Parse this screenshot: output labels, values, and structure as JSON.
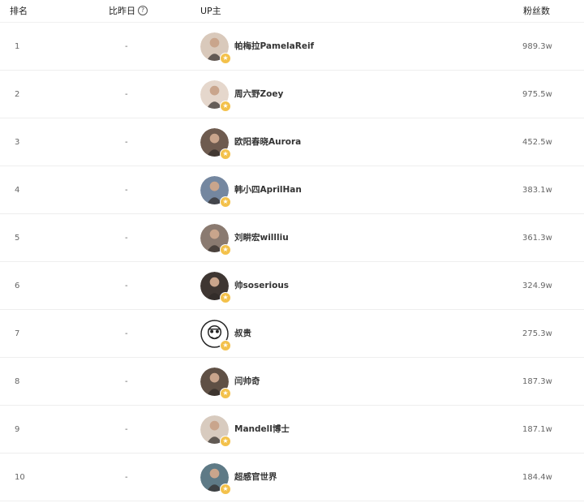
{
  "header": {
    "rank": "排名",
    "change": "比昨日",
    "up": "UP主",
    "fans": "粉丝数"
  },
  "rows": [
    {
      "rank": "1",
      "change": "-",
      "name": "帕梅拉PamelaReif",
      "fans": "989.3w",
      "avatar_color": "#d9c9bb"
    },
    {
      "rank": "2",
      "change": "-",
      "name": "周六野Zoey",
      "fans": "975.5w",
      "avatar_color": "#e5d7cc"
    },
    {
      "rank": "3",
      "change": "-",
      "name": "欧阳春晓Aurora",
      "fans": "452.5w",
      "avatar_color": "#6e5b4f"
    },
    {
      "rank": "4",
      "change": "-",
      "name": "韩小四AprilHan",
      "fans": "383.1w",
      "avatar_color": "#7487a0"
    },
    {
      "rank": "5",
      "change": "-",
      "name": "刘畊宏willliu",
      "fans": "361.3w",
      "avatar_color": "#8a7a70"
    },
    {
      "rank": "6",
      "change": "-",
      "name": "帅soserious",
      "fans": "324.9w",
      "avatar_color": "#3e3632"
    },
    {
      "rank": "7",
      "change": "-",
      "name": "叔贵",
      "fans": "275.3w",
      "avatar_color": "#ffffff"
    },
    {
      "rank": "8",
      "change": "-",
      "name": "闫帅奇",
      "fans": "187.3w",
      "avatar_color": "#5f5045"
    },
    {
      "rank": "9",
      "change": "-",
      "name": "Mandell博士",
      "fans": "187.1w",
      "avatar_color": "#d8cbbf"
    },
    {
      "rank": "10",
      "change": "-",
      "name": "超感官世界",
      "fans": "184.4w",
      "avatar_color": "#5e7a86"
    }
  ],
  "colors": {
    "badge": "#f3c14b",
    "divider": "#eeeeee"
  }
}
